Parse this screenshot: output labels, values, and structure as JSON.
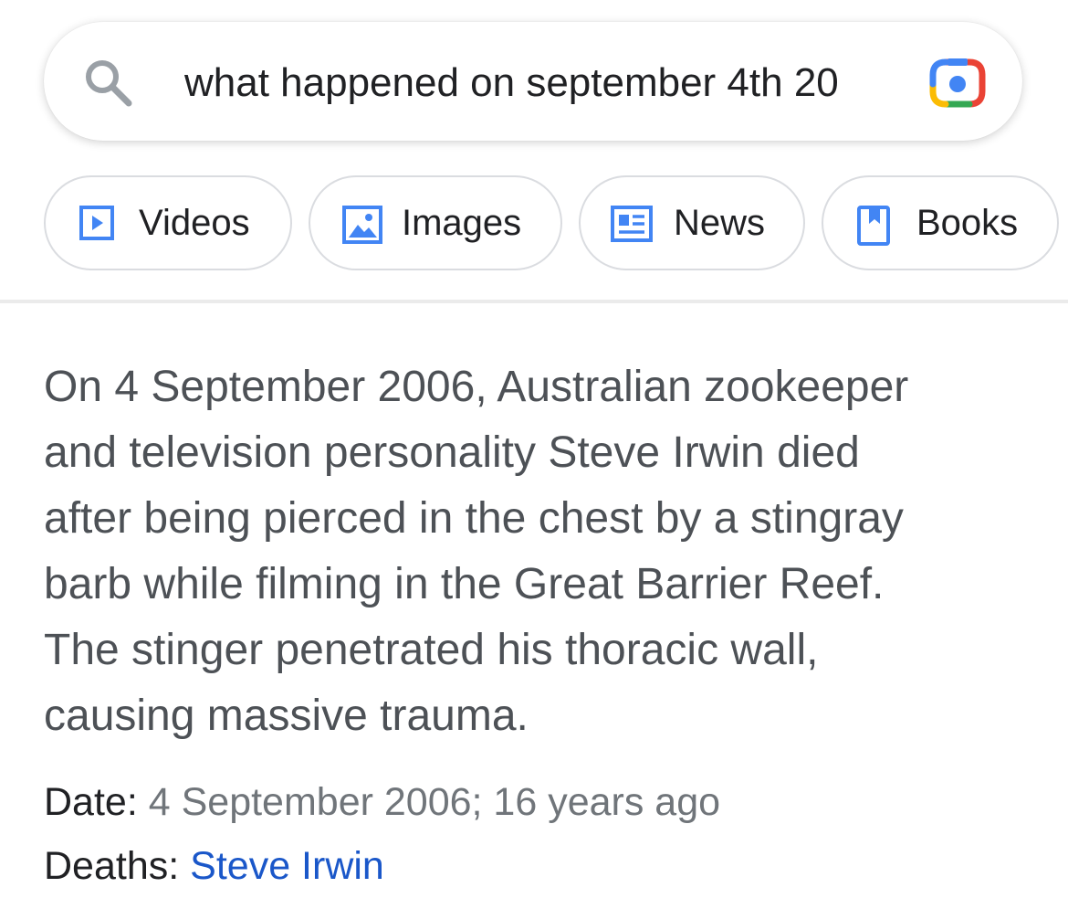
{
  "search": {
    "query": "what happened on september 4th 20"
  },
  "chips": [
    {
      "label": "Videos",
      "icon": "video-icon"
    },
    {
      "label": "Images",
      "icon": "image-icon"
    },
    {
      "label": "News",
      "icon": "news-icon"
    },
    {
      "label": "Books",
      "icon": "book-icon"
    }
  ],
  "answer": {
    "lines": [
      "On 4 September 2006, Australian zookeeper",
      "and television personality Steve Irwin died",
      "after being pierced in the chest by a stingray",
      "barb while filming in the Great Barrier Reef.",
      "The stinger penetrated his thoracic wall,",
      "causing massive trauma."
    ]
  },
  "facts": {
    "date_label": "Date:",
    "date_value": "4 September 2006; 16 years ago",
    "deaths_label": "Deaths:",
    "deaths_value": "Steve Irwin"
  },
  "colors": {
    "accent_blue": "#4285f4",
    "link": "#1a57c9",
    "text_gray": "#4d5156"
  }
}
